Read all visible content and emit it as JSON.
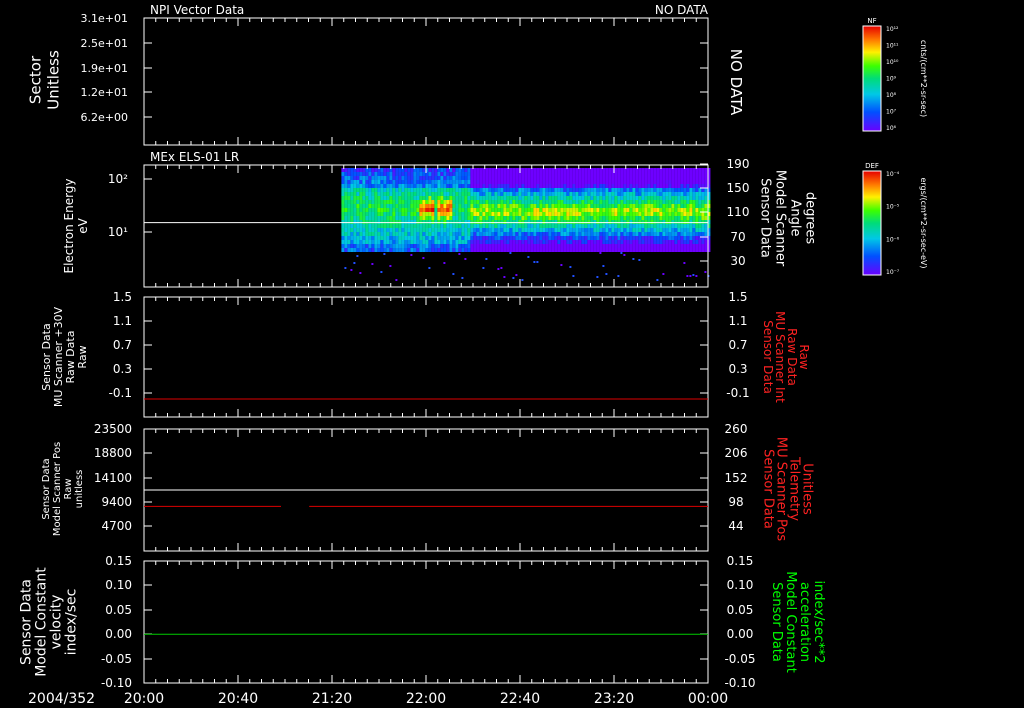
{
  "chart_data": [
    {
      "type": "line",
      "title": "NPI Vector Data",
      "status": "NO DATA",
      "side_text": "NO DATA",
      "ylabel": [
        "Sector",
        "Unitless"
      ],
      "yticks": [
        "3.1e+01",
        "2.5e+01",
        "1.9e+01",
        "1.2e+01",
        "6.2e+00"
      ],
      "series": []
    },
    {
      "type": "heatmap",
      "title": "MEx ELS-01 LR",
      "ylabel": [
        "Electron Energy",
        "eV"
      ],
      "yticks_left": [
        "10²",
        "10¹"
      ],
      "ylabel_right": [
        "Sensor Data",
        "Model Scanner",
        "Angle",
        "degrees"
      ],
      "yticks_right": [
        "190",
        "150",
        "110",
        "70",
        "30"
      ],
      "data_start": "21:24",
      "data_end": "00:00",
      "white_line_ev": 15,
      "hot_bursts": [
        "22:00",
        "22:07"
      ],
      "hot_band_start": "22:18"
    },
    {
      "type": "line",
      "ylabel": [
        "Sensor Data",
        "MU Scanner +30V",
        "Raw Data",
        "Raw"
      ],
      "yticks_left": [
        "1.5",
        "1.1",
        "0.7",
        "0.3",
        "-0.1"
      ],
      "ylim": [
        -0.3,
        1.5
      ],
      "ylabel_right": [
        "Sensor Data",
        "MU Scanner Int",
        "Raw Data",
        "Raw"
      ],
      "yticks_right": [
        "1.5",
        "1.1",
        "0.7",
        "0.3",
        "-0.1"
      ],
      "series": [
        {
          "color": "#dd0000",
          "value": -0.03
        }
      ]
    },
    {
      "type": "line",
      "ylabel": [
        "Sensor Data",
        "Model Scanner Pos",
        "Raw",
        "unitless"
      ],
      "yticks_left": [
        "23500",
        "18800",
        "14100",
        "9400",
        "4700"
      ],
      "ylim_left": [
        0,
        23500
      ],
      "ylabel_right": [
        "Sensor Data",
        "MU Scanner Pos",
        "Telemetry",
        "Unitless"
      ],
      "yticks_right": [
        "260",
        "206",
        "152",
        "98",
        "44"
      ],
      "ylim_right": [
        0,
        260
      ],
      "series": [
        {
          "color": "#ffffff",
          "value": 11750
        },
        {
          "color": "#dd0000",
          "value": 8600,
          "gap": [
            "21:00",
            "21:12"
          ]
        }
      ]
    },
    {
      "type": "line",
      "ylabel": [
        "Sensor Data",
        "Model Constant",
        "velocity",
        "index/sec"
      ],
      "yticks_left": [
        "0.15",
        "0.10",
        "0.05",
        "0.00",
        "-0.05",
        "-0.10"
      ],
      "ylim": [
        -0.1,
        0.15
      ],
      "ylabel_right": [
        "Sensor Data",
        "Model Constant",
        "acceleration",
        "index/sec**2"
      ],
      "yticks_right": [
        "0.15",
        "0.10",
        "0.05",
        "0.00",
        "-0.05",
        "-0.10"
      ],
      "series": [
        {
          "color": "#00cc00",
          "value": 0.0
        }
      ]
    }
  ],
  "xaxis": {
    "date": "2004/352",
    "ticks": [
      "20:00",
      "20:40",
      "21:20",
      "22:00",
      "22:40",
      "23:20",
      "00:00"
    ]
  },
  "colorbars": [
    {
      "label": "NF",
      "unit": "cnts/(cm**2-sr-sec)",
      "ticks": [
        "10¹²",
        "10¹¹",
        "10¹⁰",
        "10⁹",
        "10⁸",
        "10⁷",
        "10⁶"
      ]
    },
    {
      "label": "DEF",
      "unit": "ergs/(cm**2-sr-sec-eV)",
      "ticks": [
        "10⁻⁴",
        "10⁻⁵",
        "10⁻⁶",
        "10⁻⁷"
      ]
    }
  ],
  "colors": {
    "background": "#000000",
    "axes": "#ffffff",
    "red_label": "#ff2222",
    "green_label": "#00ff00"
  }
}
